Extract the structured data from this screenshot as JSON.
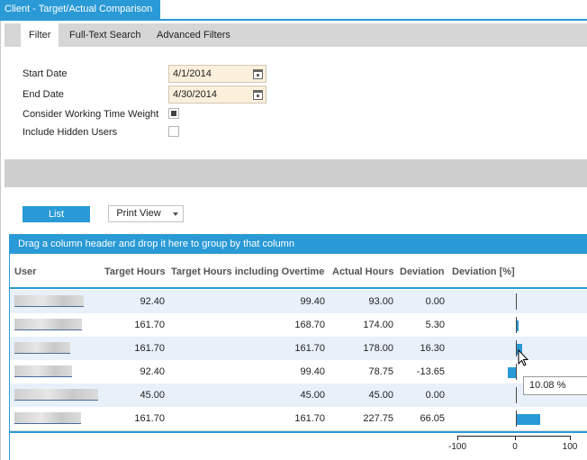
{
  "window": {
    "title": "Client - Target/Actual Comparison"
  },
  "tabs": [
    "Filter",
    "Full-Text Search",
    "Advanced Filters"
  ],
  "filters": {
    "start_date_label": "Start Date",
    "start_date": "4/1/2014",
    "end_date_label": "End Date",
    "end_date": "4/30/2014",
    "working_time_label": "Consider Working Time Weight",
    "working_time_checked": true,
    "hidden_users_label": "Include Hidden Users",
    "hidden_users_checked": false
  },
  "toolbar": {
    "list_label": "List",
    "print_label": "Print View"
  },
  "grid": {
    "group_hint": "Drag a column header and drop it here to group by that column",
    "columns": [
      "User",
      "Target Hours",
      "Target Hours including Overtime",
      "Actual Hours",
      "Deviation",
      "Deviation [%]"
    ],
    "rows": [
      {
        "target": "92.40",
        "target_ot": "99.40",
        "actual": "93.00",
        "deviation": "0.00",
        "deviation_pct": 0
      },
      {
        "target": "161.70",
        "target_ot": "168.70",
        "actual": "174.00",
        "deviation": "5.30",
        "deviation_pct": 3.28
      },
      {
        "target": "161.70",
        "target_ot": "161.70",
        "actual": "178.00",
        "deviation": "16.30",
        "deviation_pct": 10.08
      },
      {
        "target": "92.40",
        "target_ot": "99.40",
        "actual": "78.75",
        "deviation": "-13.65",
        "deviation_pct": -14.77
      },
      {
        "target": "45.00",
        "target_ot": "45.00",
        "actual": "45.00",
        "deviation": "0.00",
        "deviation_pct": 0
      },
      {
        "target": "161.70",
        "target_ot": "161.70",
        "actual": "227.75",
        "deviation": "66.05",
        "deviation_pct": 40.85
      }
    ],
    "axis_ticks": [
      "-100",
      "0",
      "100"
    ],
    "tooltip": "10.08 %"
  },
  "colors": {
    "accent": "#2a9ad6",
    "alt_row": "#e8f1fa",
    "date_bg": "#fbf0dc"
  }
}
